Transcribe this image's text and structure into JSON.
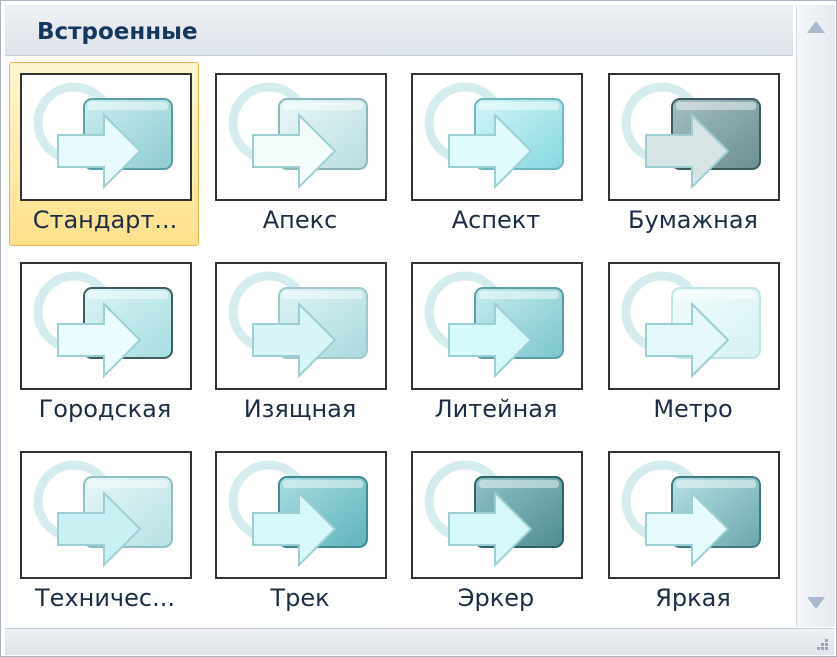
{
  "gallery": {
    "title": "Встроенные",
    "items": [
      {
        "label": "Стандарт...",
        "selected": true,
        "icon": "theme-standard-icon"
      },
      {
        "label": "Апекс",
        "selected": false,
        "icon": "theme-apex-icon"
      },
      {
        "label": "Аспект",
        "selected": false,
        "icon": "theme-aspect-icon"
      },
      {
        "label": "Бумажная",
        "selected": false,
        "icon": "theme-paper-icon"
      },
      {
        "label": "Городская",
        "selected": false,
        "icon": "theme-urban-icon"
      },
      {
        "label": "Изящная",
        "selected": false,
        "icon": "theme-elegant-icon"
      },
      {
        "label": "Литейная",
        "selected": false,
        "icon": "theme-foundry-icon"
      },
      {
        "label": "Метро",
        "selected": false,
        "icon": "theme-metro-icon"
      },
      {
        "label": "Техничес...",
        "selected": false,
        "icon": "theme-technic-icon"
      },
      {
        "label": "Трек",
        "selected": false,
        "icon": "theme-trek-icon"
      },
      {
        "label": "Эркер",
        "selected": false,
        "icon": "theme-oriel-icon"
      },
      {
        "label": "Яркая",
        "selected": false,
        "icon": "theme-vivid-icon"
      }
    ]
  },
  "colors": {
    "accent": "#e8b64a",
    "title_text": "#15375e",
    "icon_teal": "#9fd3d8"
  },
  "scrollbar": {
    "up_icon": "scroll-up-arrow-icon",
    "down_icon": "scroll-down-arrow-icon"
  }
}
